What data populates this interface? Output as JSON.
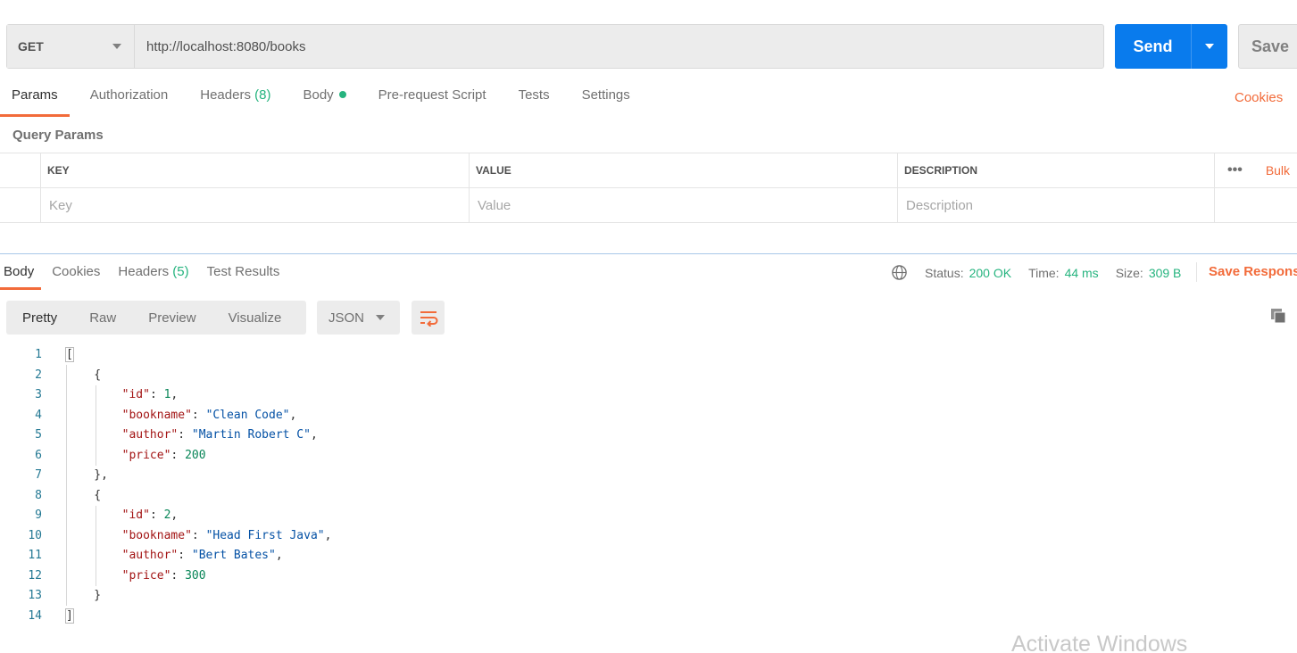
{
  "request": {
    "method": "GET",
    "url": "http://localhost:8080/books",
    "send_label": "Send",
    "save_label": "Save"
  },
  "request_tabs": [
    {
      "label": "Params",
      "active": true
    },
    {
      "label": "Authorization"
    },
    {
      "label": "Headers",
      "count": "(8)"
    },
    {
      "label": "Body",
      "dot": true
    },
    {
      "label": "Pre-request Script"
    },
    {
      "label": "Tests"
    },
    {
      "label": "Settings"
    }
  ],
  "cookies_link": "Cookies",
  "query_params": {
    "title": "Query Params",
    "columns": {
      "key": "KEY",
      "value": "VALUE",
      "description": "DESCRIPTION",
      "bulk": "Bulk"
    },
    "placeholders": {
      "key": "Key",
      "value": "Value",
      "description": "Description"
    }
  },
  "response_tabs": [
    {
      "label": "Body",
      "active": true
    },
    {
      "label": "Cookies"
    },
    {
      "label": "Headers",
      "count": "(5)"
    },
    {
      "label": "Test Results"
    }
  ],
  "status": {
    "status_label": "Status:",
    "status_value": "200 OK",
    "time_label": "Time:",
    "time_value": "44 ms",
    "size_label": "Size:",
    "size_value": "309 B",
    "save_response": "Save Respons"
  },
  "view_tabs": [
    "Pretty",
    "Raw",
    "Preview",
    "Visualize"
  ],
  "format": "JSON",
  "code_lines": [
    "[",
    "    {",
    "        \"id\": 1,",
    "        \"bookname\": \"Clean Code\",",
    "        \"author\": \"Martin Robert C\",",
    "        \"price\": 200",
    "    },",
    "    {",
    "        \"id\": 2,",
    "        \"bookname\": \"Head First Java\",",
    "        \"author\": \"Bert Bates\",",
    "        \"price\": 300",
    "    }",
    "]"
  ],
  "watermark": "Activate Windows",
  "colors": {
    "accent": "#f26b3a",
    "send": "#097bed",
    "success": "#26b47f"
  }
}
